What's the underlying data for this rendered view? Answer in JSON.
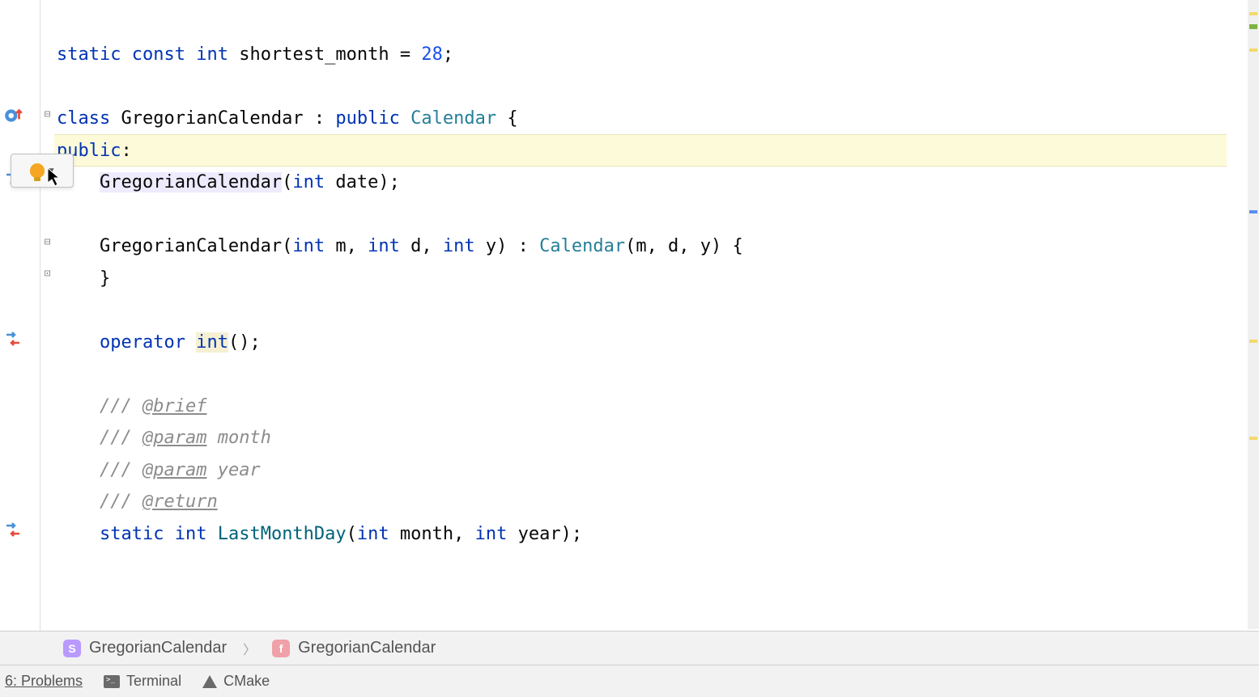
{
  "code": {
    "line1_kw1": "static",
    "line1_kw2": "const",
    "line1_kw3": "int",
    "line1_ident": "shortest_month",
    "line1_eq": " = ",
    "line1_num": "28",
    "line1_semi": ";",
    "line3_kw1": "class",
    "line3_name": "GregorianCalendar",
    "line3_colon": " : ",
    "line3_kw2": "public",
    "line3_base": "Calendar",
    "line3_brace": " {",
    "line4_kw": "public",
    "line4_colon": ":",
    "line5_name": "GregorianCalendar",
    "line5_paren_open": "(",
    "line5_type": "int",
    "line5_param": " date",
    "line5_close": ");",
    "line7_name": "GregorianCalendar",
    "line7_paren_open": "(",
    "line7_t1": "int",
    "line7_p1": " m, ",
    "line7_t2": "int",
    "line7_p2": " d, ",
    "line7_t3": "int",
    "line7_p3": " y) : ",
    "line7_base": "Calendar",
    "line7_args": "(m, d, y) {",
    "line8_brace": "}",
    "line10_kw": "operator",
    "line10_type": "int",
    "line10_close": "();",
    "line12_prefix": "/// ",
    "line12_tag": "@brief",
    "line13_prefix": "/// ",
    "line13_tag": "@param",
    "line13_rest": " month",
    "line14_prefix": "/// ",
    "line14_tag": "@param",
    "line14_rest": " year",
    "line15_prefix": "/// ",
    "line15_tag": "@return",
    "line16_kw1": "static",
    "line16_kw2": "int",
    "line16_name": "LastMonthDay",
    "line16_paren_open": "(",
    "line16_t1": "int",
    "line16_p1": " month, ",
    "line16_t2": "int",
    "line16_p2": " year",
    "line16_close": ");"
  },
  "breadcrumb": {
    "item1_badge": "S",
    "item1_label": "GregorianCalendar",
    "item2_badge": "f",
    "item2_label": "GregorianCalendar"
  },
  "bottom_bar": {
    "problems_label": "6: Problems",
    "terminal_label": "Terminal",
    "cmake_label": "CMake"
  }
}
